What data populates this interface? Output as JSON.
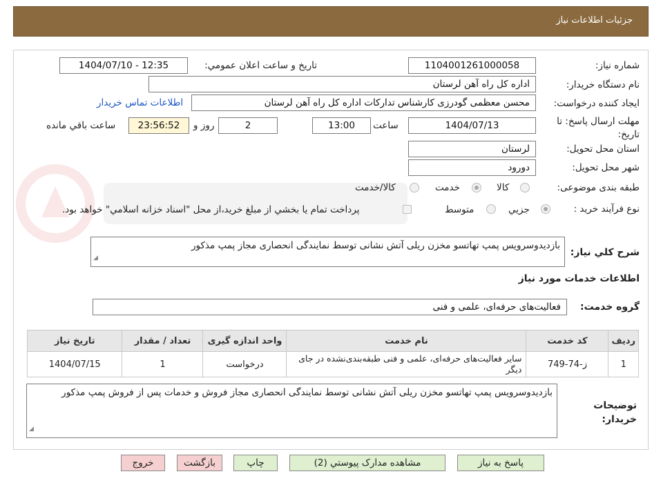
{
  "header": {
    "title": "جزئیات اطلاعات نیاز"
  },
  "form": {
    "need_number_label": "شماره نیاز:",
    "need_number": "1104001261000058",
    "announce_label": "تاریخ و ساعت اعلان عمومي:",
    "announce_value": "1404/07/10 - 12:35",
    "buyer_org_label": "نام دستگاه خريدار:",
    "buyer_org": "اداره کل راه آهن لرستان",
    "requester_label": "ايجاد کننده درخواست:",
    "requester": "محسن معظمی گودرزی کارشناس تدارکات اداره کل راه آهن لرستان",
    "contact_link": "اطلاعات تماس خريدار",
    "deadline_label": "مهلت ارسال پاسخ: تا تاریخ:",
    "deadline_date": "1404/07/13",
    "time_label": "ساعت",
    "deadline_time": "13:00",
    "days_value": "2",
    "days_label": "روز و",
    "remaining_time": "23:56:52",
    "remaining_label": "ساعت باقي مانده",
    "province_label": "استان محل تحویل:",
    "province": "لرستان",
    "city_label": "شهر محل تحویل:",
    "city": "دورود",
    "category_label": "طبقه بندی موضوعی:",
    "category_options": [
      "کالا",
      "خدمت",
      "کالا/خدمت"
    ],
    "process_label": "نوع فرآیند خرید :",
    "process_options": [
      "جزيي",
      "متوسط"
    ],
    "treasury_note": "پرداخت تمام يا بخشي از مبلغ خريد،از محل \"اسناد خزانه اسلامي\" خواهد بود."
  },
  "description": {
    "label": "شرح کلي نياز:",
    "value": "بازدیدوسرویس پمپ تهاتسو مخزن ریلی آتش نشانی توسط نمایندگی انحصاری مجاز پمپ مذکور"
  },
  "services": {
    "section_title": "اطلاعات خدمات مورد نياز",
    "group_label": "گروه خدمت:",
    "group_value": "فعالیت‌های حرفه‌ای، علمی و فنی",
    "columns": [
      "رديف",
      "کد خدمت",
      "نام خدمت",
      "واحد اندازه گيری",
      "تعداد / مقدار",
      "تاريخ نياز"
    ],
    "rows": [
      [
        "1",
        "ز-74-749",
        "سایر فعالیت‌های حرفه‌ای، علمی و فنی طبقه‌بندی‌نشده در جای دیگر",
        "درخواست",
        "1",
        "1404/07/15"
      ]
    ]
  },
  "buyer_notes": {
    "label": "توضيحات خريدار:",
    "value": "بازدیدوسرویس پمپ تهاتسو مخزن ریلی آتش نشانی توسط نمایندگی انحصاری مجاز فروش و خدمات پس از فروش پمپ مذکور"
  },
  "buttons": {
    "reply": "پاسخ به نياز",
    "attachments": "مشاهده مدارک پيوستي (2)",
    "print": "چاپ",
    "back": "بازگشت",
    "exit": "خروج"
  },
  "colors": {
    "header_bg": "#8a6a3e",
    "exit_bg": "#f6d0d0",
    "action_bg": "#dff0d0"
  }
}
